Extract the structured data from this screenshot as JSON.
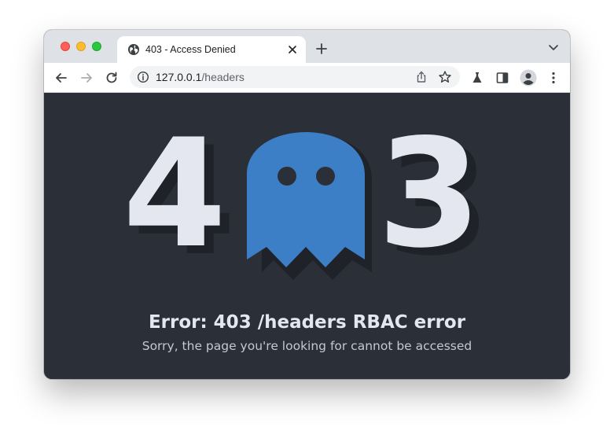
{
  "browser": {
    "tab": {
      "title": "403 - Access Denied",
      "icon": "globe-icon"
    },
    "address_bar": {
      "host": "127.0.0.1",
      "path": "/headers"
    },
    "icons": [
      "back-arrow-icon",
      "forward-arrow-icon",
      "reload-icon",
      "info-icon",
      "share-icon",
      "bookmark-star-icon",
      "labs-flask-icon",
      "side-panel-icon",
      "profile-avatar-icon",
      "kebab-menu-icon"
    ]
  },
  "page": {
    "digit_left": "4",
    "digit_right": "3",
    "mascot": "ghost-icon",
    "error_title": "Error: 403 /headers RBAC error",
    "error_subtitle": "Sorry, the page you're looking for cannot be accessed"
  },
  "colors": {
    "background": "#2b3038",
    "digits": "#e4e7ef",
    "ghost": "#3d7fc6",
    "shadow": "#1f2329"
  }
}
